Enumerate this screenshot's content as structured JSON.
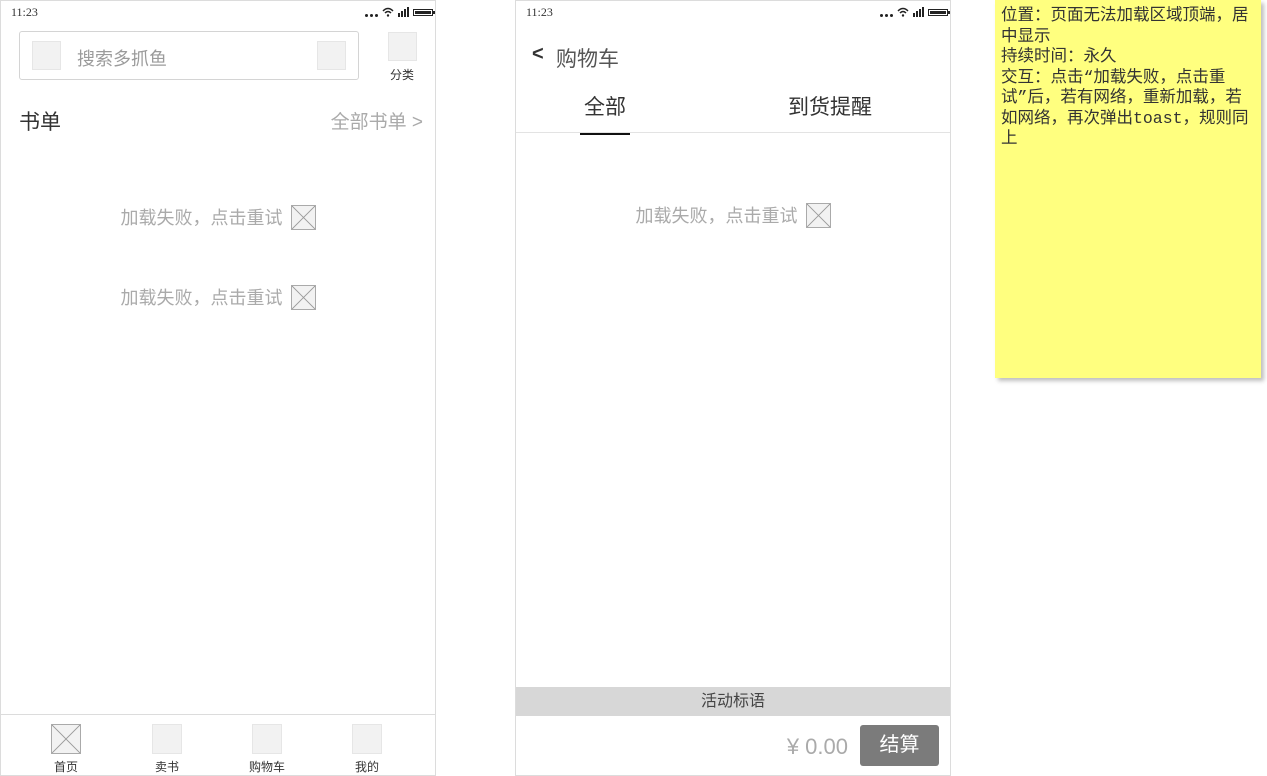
{
  "phone1": {
    "status_time": "11:23",
    "search_placeholder": "搜索多抓鱼",
    "category_label": "分类",
    "section_title": "书单",
    "section_link": "全部书单 >",
    "retry_messages": [
      "加载失败，点击重试",
      "加载失败，点击重试"
    ],
    "tabbar": [
      {
        "label": "首页",
        "icon": "home-icon"
      },
      {
        "label": "卖书",
        "icon": "sell-icon"
      },
      {
        "label": "购物车",
        "icon": "cart-icon"
      },
      {
        "label": "我的",
        "icon": "profile-icon"
      }
    ]
  },
  "phone2": {
    "status_time": "11:23",
    "back_symbol": "<",
    "title": "购物车",
    "tabs": [
      {
        "label": "全部",
        "active": true
      },
      {
        "label": "到货提醒",
        "active": false
      }
    ],
    "retry_message": "加载失败，点击重试",
    "promo_text": "活动标语",
    "price": "¥ 0.00",
    "checkout_label": "结算"
  },
  "note": {
    "lines": [
      "位置：页面无法加载区域顶端，居中显示",
      "持续时间：永久",
      "交互：点击“加载失败，点击重试”后，若有网络，重新加载，若如网络，再次弹出toast，规则同上"
    ],
    "background": "#ffff7f"
  }
}
